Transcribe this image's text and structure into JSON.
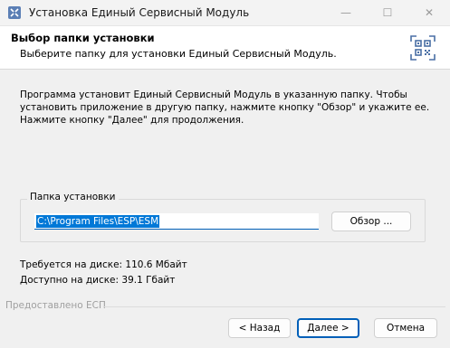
{
  "window": {
    "title": "Установка Единый Сервисный Модуль",
    "controls": {
      "minimize": "—",
      "maximize": "☐",
      "close": "✕"
    }
  },
  "header": {
    "title": "Выбор папки установки",
    "subtitle": "Выберите папку для установки Единый Сервисный Модуль."
  },
  "body": {
    "lines": [
      "Программа установит Единый Сервисный Модуль в указанную папку. Чтобы",
      "установить приложение в другую папку, нажмите кнопку \"Обзор\" и укажите ее.",
      "Нажмите кнопку \"Далее\" для продолжения."
    ]
  },
  "install_folder": {
    "label": "Папка установки",
    "path": "C:\\Program Files\\ESP\\ESM",
    "browse_label": "Обзор ..."
  },
  "disk": {
    "required": "Требуется на диске: 110.6 Мбайт",
    "available": "Доступно на диске: 39.1 Гбайт"
  },
  "footer": {
    "brand": "Предоставлено ЕСП",
    "back_label": "< Назад",
    "next_label": "Далее >",
    "cancel_label": "Отмена"
  },
  "colors": {
    "accent": "#005fb8",
    "selection": "#0078d7",
    "logo": "#4a6fa5"
  }
}
